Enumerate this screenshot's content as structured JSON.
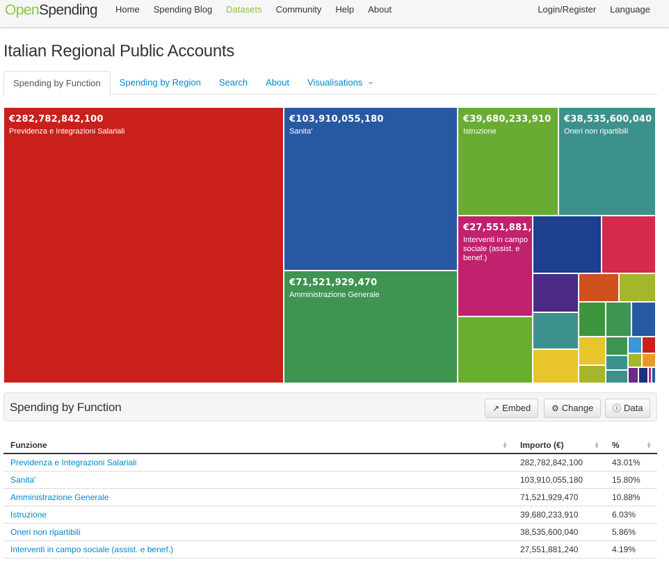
{
  "nav": {
    "brand_open": "Open",
    "brand_spending": "Spending",
    "links": [
      "Home",
      "Spending Blog",
      "Datasets",
      "Community",
      "Help",
      "About"
    ],
    "right": [
      "Login/Register",
      "Language"
    ],
    "active_color": "#8dc63f"
  },
  "page": {
    "title": "Italian Regional Public Accounts"
  },
  "tabs": [
    "Spending by Function",
    "Spending by Region",
    "Search",
    "About",
    "Visualisations"
  ],
  "treemap": [
    {
      "amount": "€282,782,842,100",
      "label": "Previdenza e Integrazioni Salariali",
      "color": "#c9201c"
    },
    {
      "amount": "€103,910,055,180",
      "label": "Sanita'",
      "color": "#2759a3"
    },
    {
      "amount": "€71,521,929,470",
      "label": "Amministrazione Generale",
      "color": "#3f9452"
    },
    {
      "amount": "€39,680,233,910",
      "label": "Istruzione",
      "color": "#69ac33"
    },
    {
      "amount": "€38,535,600,040",
      "label": "Oneri non ripartibili",
      "color": "#3d918c"
    },
    {
      "amount": "€27,551,881,240",
      "label": "Interventi in campo sociale (assist. e benef.)",
      "color": "#c2216e"
    },
    {
      "amount": "",
      "label": "",
      "color": "#1e3e8e"
    },
    {
      "amount": "",
      "label": "",
      "color": "#d42a4c"
    },
    {
      "amount": "",
      "label": "",
      "color": "#6aae2e"
    },
    {
      "amount": "",
      "label": "",
      "color": "#4a2a84"
    },
    {
      "amount": "",
      "label": "",
      "color": "#d0511e"
    },
    {
      "amount": "",
      "label": "",
      "color": "#a5b62b"
    },
    {
      "amount": "",
      "label": "",
      "color": "#3c918e"
    },
    {
      "amount": "",
      "label": "",
      "color": "#3d963e"
    },
    {
      "amount": "",
      "label": "",
      "color": "#3f9452"
    },
    {
      "amount": "",
      "label": "",
      "color": "#2759a3"
    },
    {
      "amount": "",
      "label": "",
      "color": "#e8c52b"
    },
    {
      "amount": "",
      "label": "",
      "color": "#e8c52b"
    },
    {
      "amount": "",
      "label": "",
      "color": "#a5b62b"
    },
    {
      "amount": "",
      "label": "",
      "color": "#3f9452"
    },
    {
      "amount": "",
      "label": "",
      "color": "#3d918c"
    },
    {
      "amount": "",
      "label": "",
      "color": "#3d918c"
    },
    {
      "amount": "",
      "label": "",
      "color": "#3b98d8"
    },
    {
      "amount": "",
      "label": "",
      "color": "#c9201c"
    },
    {
      "amount": "",
      "label": "",
      "color": "#a5b62b"
    },
    {
      "amount": "",
      "label": "",
      "color": "#e89a28"
    },
    {
      "amount": "",
      "label": "",
      "color": "#6c2a86"
    },
    {
      "amount": "",
      "label": "",
      "color": "#1e2f7c"
    },
    {
      "amount": "",
      "label": "",
      "color": "#c2216e"
    },
    {
      "amount": "",
      "label": "",
      "color": "#2759a3"
    }
  ],
  "panel": {
    "title": "Spending by Function",
    "buttons": [
      {
        "label": "Embed",
        "icon": "share-icon"
      },
      {
        "label": "Change",
        "icon": "gear-icon"
      },
      {
        "label": "Data",
        "icon": "info-icon"
      }
    ]
  },
  "table": {
    "headers": [
      "Funzione",
      "Importo (€)",
      "%"
    ],
    "rows": [
      [
        "Previdenza e Integrazioni Salariali",
        "282,782,842,100",
        "43.01%"
      ],
      [
        "Sanita'",
        "103,910,055,180",
        "15.80%"
      ],
      [
        "Amministrazione Generale",
        "71,521,929,470",
        "10.88%"
      ],
      [
        "Istruzione",
        "39,680,233,910",
        "6.03%"
      ],
      [
        "Oneri non ripartibili",
        "38,535,600,040",
        "5.86%"
      ],
      [
        "Interventi in campo sociale (assist. e benef.)",
        "27,551,881,240",
        "4.19%"
      ]
    ]
  }
}
